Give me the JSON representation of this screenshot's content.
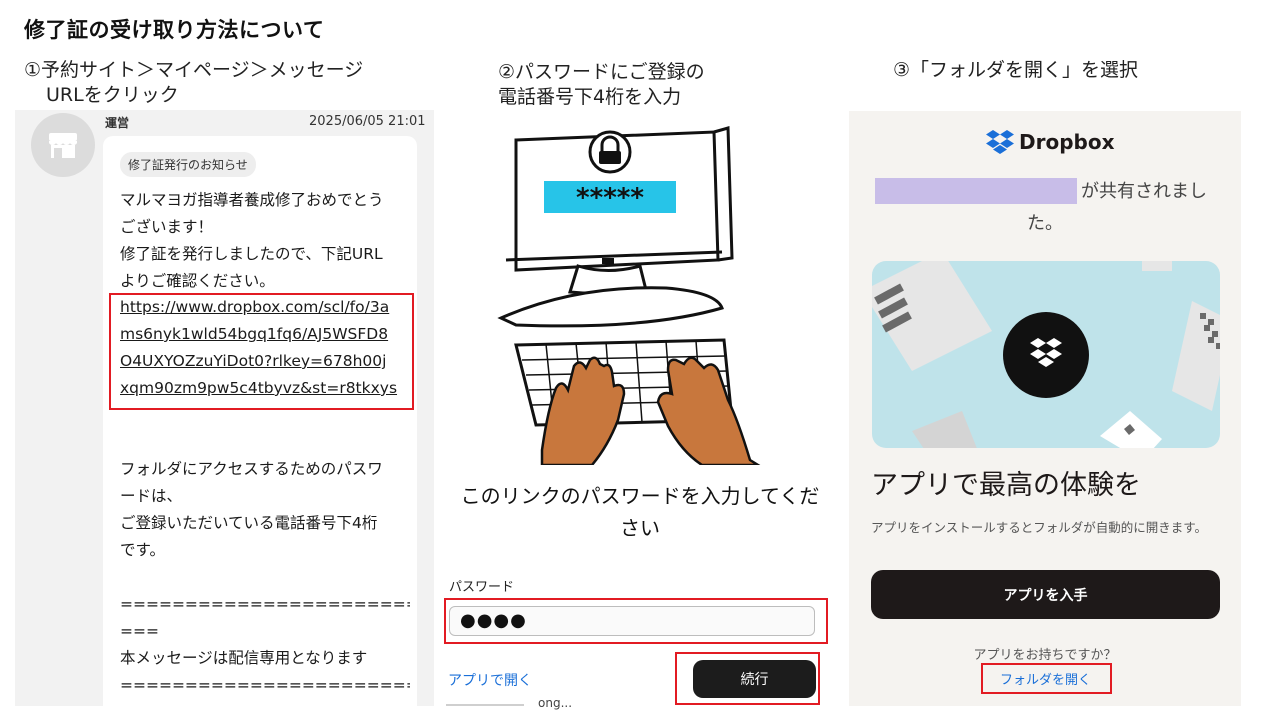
{
  "title": "修了証の受け取り方法について",
  "steps": {
    "step1_line1": "①予約サイト＞マイページ＞メッセージ",
    "step1_line2": "URLをクリック",
    "step2_line1": "②パスワードにご登録の",
    "step2_line2": "電話番号下4桁を入力",
    "step3": "③「フォルダを開く」を選択"
  },
  "message": {
    "sender": "運営",
    "timestamp": "2025/06/05 21:01",
    "tag": "修了証発行のお知らせ",
    "body_lines_1": [
      "マルマヨガ指導者養成修了おめでとう",
      "ございます！",
      "修了証を発行しましたので、下記URL",
      "よりご確認ください。"
    ],
    "link_lines": [
      "https://www.dropbox.com/scl/fo/3a",
      "ms6nyk1wld54bgq1fq6/AJ5WSFD8",
      "O4UXYOZzuYiDot0?rlkey=678h00j",
      "xqm90zm9pw5c4tbyvz&st=r8tkxys"
    ],
    "body_lines_2": [
      "フォルダにアクセスするためのパスワ",
      "ードは、",
      "ご登録いただいている電話番号下4桁",
      "です。"
    ],
    "separator_lines": [
      "==========================",
      "==="
    ],
    "notice": "本メッセージは配信専用となります",
    "separator_bottom": "=========================="
  },
  "password_screen": {
    "banner_stars": "*****",
    "heading_line1": "このリンクのパスワードを入力してくだ",
    "heading_line2": "さい",
    "label": "パスワード",
    "input_value": "●●●●",
    "open_in_app": "アプリで開く",
    "continue": "続行",
    "cut_text": "ong..."
  },
  "dropbox_screen": {
    "brand": "Dropbox",
    "shared_line1": "が共有されまし",
    "shared_line2": "た。",
    "heading": "アプリで最高の体験を",
    "description": "アプリをインストールするとフォルダが自動的に開きます。",
    "get_app": "アプリを入手",
    "have_app": "アプリをお持ちですか？",
    "open_folder": "フォルダを開く"
  },
  "colors": {
    "highlight_red": "#e21b23",
    "link_blue": "#1a6fd8",
    "redaction_purple": "#c8bde8",
    "banner_cyan": "#27c4e8",
    "illustration_teal": "#bfe3ea"
  }
}
